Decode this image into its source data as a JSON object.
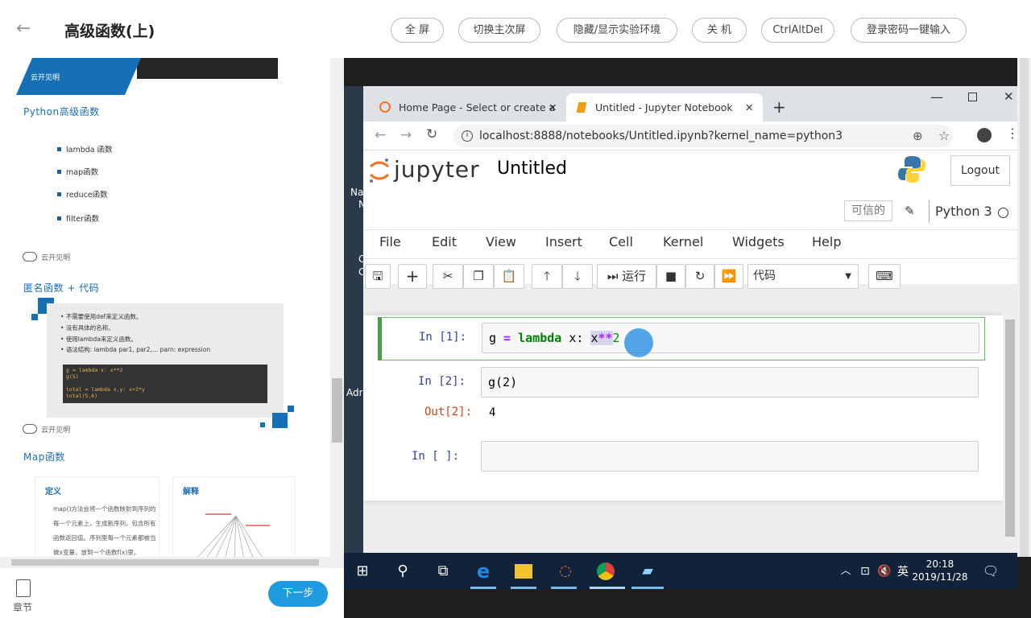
{
  "header": {
    "title": "高级函数(上)",
    "buttons": [
      "全 屏",
      "切换主次屏",
      "隐藏/显示实验环境",
      "关 机",
      "CtrlAltDel",
      "登录密码一键输入"
    ]
  },
  "slides": {
    "logo_text": "云开见明",
    "section1_title": "Python高级函数",
    "bullets": [
      "lambda 函数",
      "map函数",
      "reduce函数",
      "filter函数"
    ],
    "section2_title": "匿名函数 + 代码",
    "anon_points": [
      "不需要使用def来定义函数。",
      "没有具体的名称。",
      "使用lambda来定义函数。",
      "语法结构: lambda par1, par2,… parn: expression"
    ],
    "code_lines": [
      "g = lambda x: x**2",
      "g(5)",
      "",
      "total = lambda x,y: x+2*y",
      "total(5,6)"
    ],
    "section3_title": "Map函数",
    "card1_title": "定义",
    "card1_text": "map()方法会将一个函数映射到序列的每一个元素上，生成新序列，包含所有函数返回值。序列里每一个元素都被当做x变量，放到一个函数f(x)里，",
    "card2_title": "解释"
  },
  "footer": {
    "chapter_label": "章节",
    "next_label": "下一步"
  },
  "desktop": {
    "side_texts": [
      "Na",
      "N",
      "C",
      "C",
      "Adr"
    ]
  },
  "browser": {
    "tabs": [
      {
        "label": "Home Page - Select or create a"
      },
      {
        "label": "Untitled - Jupyter Notebook"
      }
    ],
    "new_tab": "+",
    "url": "localhost:8888/notebooks/Untitled.ipynb?kernel_name=python3"
  },
  "jupyter": {
    "logo": "jupyter",
    "notebook_name": "Untitled",
    "logout": "Logout",
    "trusted": "可信的",
    "kernel": "Python 3",
    "menu": [
      "File",
      "Edit",
      "View",
      "Insert",
      "Cell",
      "Kernel",
      "Widgets",
      "Help"
    ],
    "run_label": "运行",
    "cell_type": "代码",
    "cells": [
      {
        "prompt": "In  [1]:",
        "code_parts": [
          "g",
          " = ",
          "lambda",
          " x: ",
          "x",
          "**",
          "2"
        ]
      },
      {
        "prompt": "In  [2]:",
        "code": "g(2)",
        "out_prompt": "Out[2]:",
        "output": "4"
      },
      {
        "prompt": "In  [ ]:",
        "code": ""
      }
    ]
  },
  "taskbar": {
    "time": "20:18",
    "date": "2019/11/28",
    "ime": "英"
  }
}
